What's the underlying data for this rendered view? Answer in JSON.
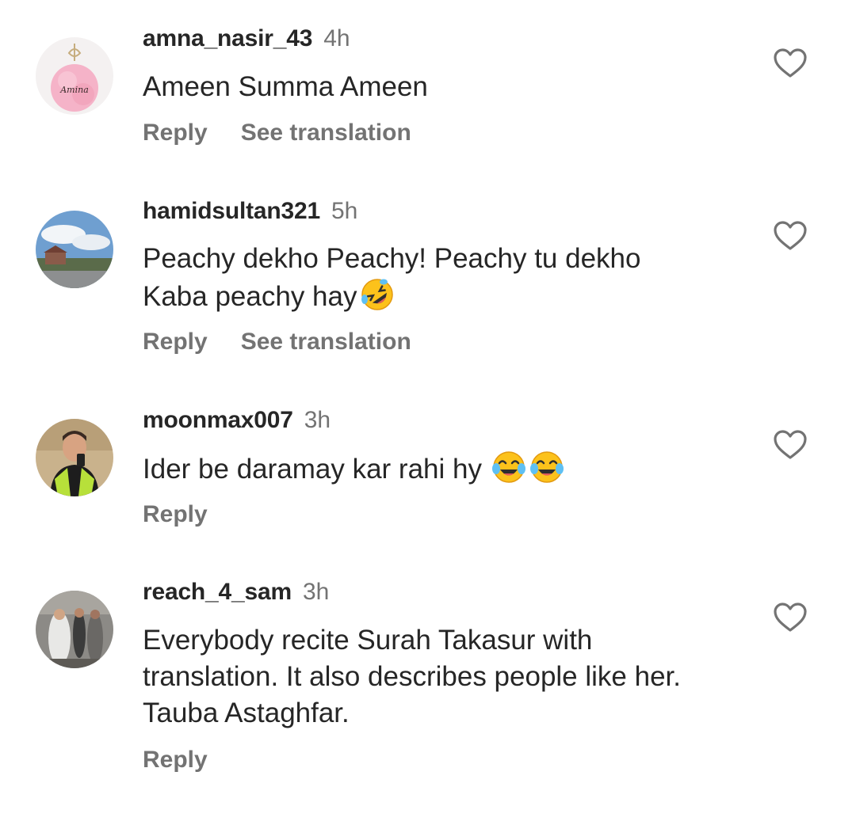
{
  "comments": [
    {
      "username": "amna_nasir_43",
      "time": "4h",
      "text": "Ameen Summa Ameen",
      "avatar_label": "Amina",
      "reply_label": "Reply",
      "translation_label": "See translation"
    },
    {
      "username": "hamidsultan321",
      "time": "5h",
      "text_line1": "Peachy dekho Peachy! Peachy tu dekho",
      "text_line2": "Kaba peachy hay",
      "reply_label": "Reply",
      "translation_label": "See translation"
    },
    {
      "username": "moonmax007",
      "time": "3h",
      "text": "Ider be daramay kar rahi hy",
      "reply_label": "Reply"
    },
    {
      "username": "reach_4_sam",
      "time": "3h",
      "text_line1": "Everybody recite Surah Takasur with",
      "text_line2": "translation. It also describes people like her.",
      "text_line3": "Tauba Astaghfar.",
      "reply_label": "Reply"
    }
  ],
  "icons": {
    "like": "heart-outline-icon",
    "emoji_rofl": "rolling-on-floor-laughing-emoji",
    "emoji_tears": "face-with-tears-of-joy-emoji"
  },
  "colors": {
    "text": "#262626",
    "secondary": "#737373",
    "background": "#ffffff"
  }
}
